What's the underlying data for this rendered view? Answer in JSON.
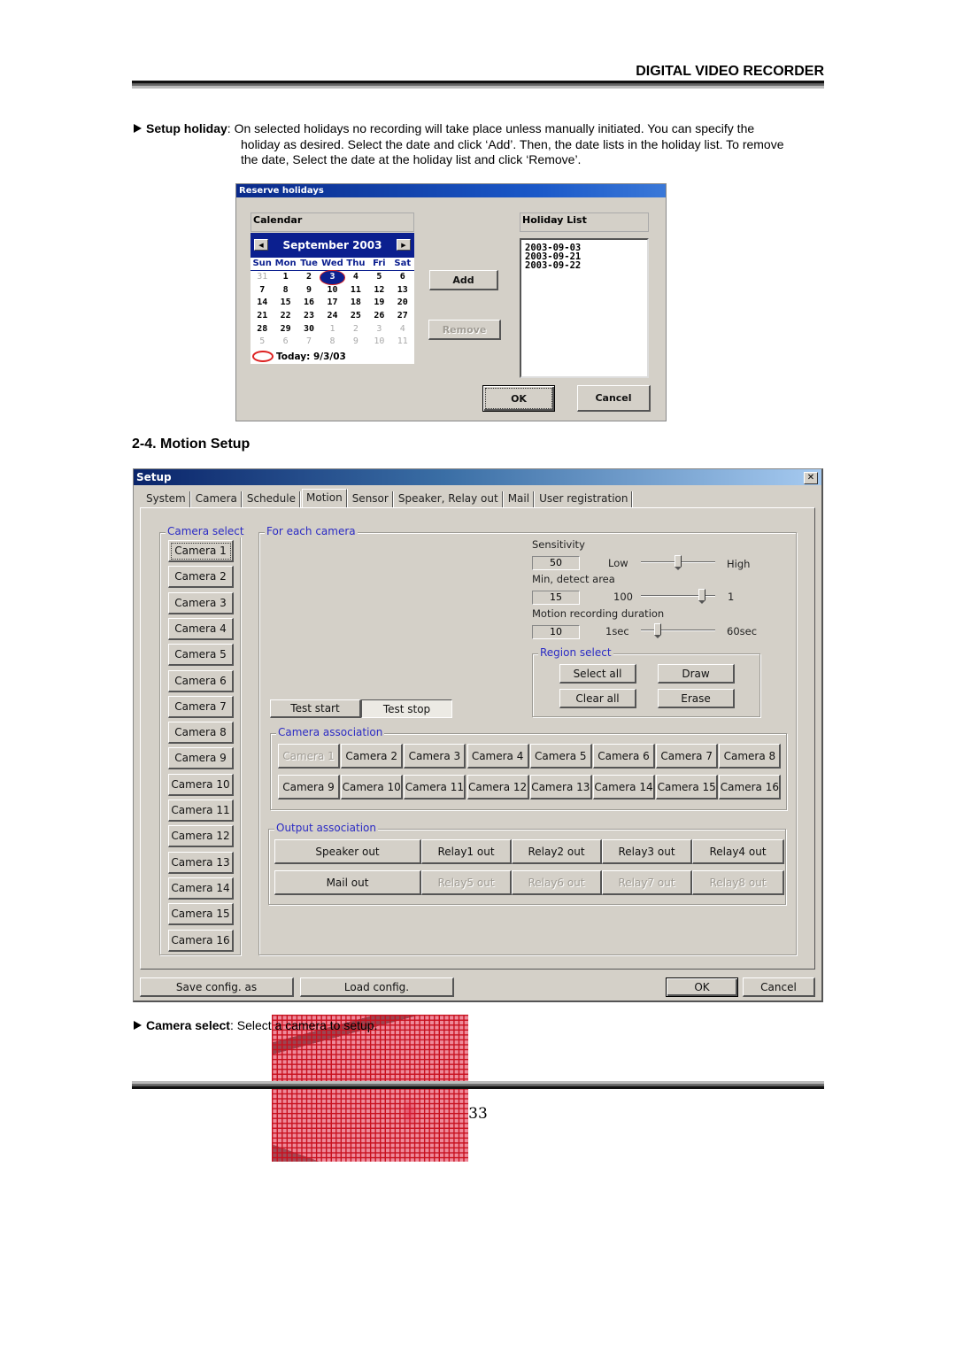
{
  "header": {
    "title": "DIGITAL VIDEO RECORDER"
  },
  "intro": {
    "lead": "Setup holiday",
    "line1": ": On selected holidays no recording will take place unless manually initiated. You can specify the",
    "line2": "holiday as desired. Select the date and click ‘Add’. Then, the date lists in the holiday list. To remove",
    "line3": "the date, Select the date at the holiday list and click ‘Remove’."
  },
  "holiday_dialog": {
    "title": "Reserve holidays",
    "calendar_label": "Calendar",
    "month_label": "September 2003",
    "prev_icon": "◀",
    "next_icon": "▶",
    "weekdays": [
      "Sun",
      "Mon",
      "Tue",
      "Wed",
      "Thu",
      "Fri",
      "Sat"
    ],
    "days": [
      {
        "d": "31",
        "other": true
      },
      {
        "d": "1"
      },
      {
        "d": "2"
      },
      {
        "d": "3",
        "selected": true
      },
      {
        "d": "4"
      },
      {
        "d": "5"
      },
      {
        "d": "6"
      },
      {
        "d": "7"
      },
      {
        "d": "8"
      },
      {
        "d": "9"
      },
      {
        "d": "10"
      },
      {
        "d": "11"
      },
      {
        "d": "12"
      },
      {
        "d": "13"
      },
      {
        "d": "14"
      },
      {
        "d": "15"
      },
      {
        "d": "16"
      },
      {
        "d": "17"
      },
      {
        "d": "18"
      },
      {
        "d": "19"
      },
      {
        "d": "20"
      },
      {
        "d": "21"
      },
      {
        "d": "22"
      },
      {
        "d": "23"
      },
      {
        "d": "24"
      },
      {
        "d": "25"
      },
      {
        "d": "26"
      },
      {
        "d": "27"
      },
      {
        "d": "28"
      },
      {
        "d": "29"
      },
      {
        "d": "30"
      },
      {
        "d": "1",
        "other": true
      },
      {
        "d": "2",
        "other": true
      },
      {
        "d": "3",
        "other": true
      },
      {
        "d": "4",
        "other": true
      },
      {
        "d": "5",
        "other": true
      },
      {
        "d": "6",
        "other": true
      },
      {
        "d": "7",
        "other": true
      },
      {
        "d": "8",
        "other": true
      },
      {
        "d": "9",
        "other": true
      },
      {
        "d": "10",
        "other": true
      },
      {
        "d": "11",
        "other": true
      }
    ],
    "today_label": "Today: 9/3/03",
    "add_label": "Add",
    "remove_label": "Remove",
    "holiday_list_label": "Holiday List",
    "holidays": [
      "2003-09-03",
      "2003-09-21",
      "2003-09-22"
    ],
    "ok_label": "OK",
    "cancel_label": "Cancel"
  },
  "section": {
    "title": "2-4. Motion Setup"
  },
  "setup_dialog": {
    "title": "Setup",
    "close_icon": "✕",
    "tabs": [
      {
        "label": "System"
      },
      {
        "label": "Camera"
      },
      {
        "label": "Schedule"
      },
      {
        "label": "Motion",
        "active": true
      },
      {
        "label": "Sensor"
      },
      {
        "label": "Speaker, Relay out"
      },
      {
        "label": "Mail"
      },
      {
        "label": "User registration"
      }
    ],
    "camera_select": {
      "label": "Camera select",
      "cameras": [
        "Camera 1",
        "Camera 2",
        "Camera 3",
        "Camera 4",
        "Camera 5",
        "Camera 6",
        "Camera 7",
        "Camera 8",
        "Camera 9",
        "Camera 10",
        "Camera 11",
        "Camera 12",
        "Camera 13",
        "Camera 14",
        "Camera 15",
        "Camera 16"
      ],
      "selected": "Camera 1"
    },
    "for_each_camera": {
      "label": "For each camera",
      "test_start": "Test start",
      "test_stop": "Test stop",
      "sensitivity": {
        "label": "Sensitivity",
        "value": "50",
        "min_label": "Low",
        "max_label": "High",
        "position": 0.5
      },
      "min_detect_area": {
        "label": "Min, detect area",
        "value": "15",
        "min_label": "100",
        "max_label": "1",
        "position": 0.86
      },
      "motion_duration": {
        "label": "Motion recording duration",
        "value": "10",
        "min_label": "1sec",
        "max_label": "60sec",
        "position": 0.2
      },
      "region_select": {
        "label": "Region select",
        "select_all": "Select all",
        "draw": "Draw",
        "clear_all": "Clear all",
        "erase": "Erase"
      }
    },
    "camera_association": {
      "label": "Camera association",
      "cameras": [
        {
          "label": "Camera 1",
          "disabled": true
        },
        {
          "label": "Camera 2"
        },
        {
          "label": "Camera 3"
        },
        {
          "label": "Camera 4"
        },
        {
          "label": "Camera 5"
        },
        {
          "label": "Camera 6"
        },
        {
          "label": "Camera 7"
        },
        {
          "label": "Camera 8"
        },
        {
          "label": "Camera 9"
        },
        {
          "label": "Camera 10"
        },
        {
          "label": "Camera 11"
        },
        {
          "label": "Camera 12"
        },
        {
          "label": "Camera 13"
        },
        {
          "label": "Camera 14"
        },
        {
          "label": "Camera 15"
        },
        {
          "label": "Camera 16"
        }
      ]
    },
    "output_association": {
      "label": "Output association",
      "outputs": [
        {
          "label": "Speaker out"
        },
        {
          "label": "Relay1 out"
        },
        {
          "label": "Relay2 out"
        },
        {
          "label": "Relay3 out"
        },
        {
          "label": "Relay4 out"
        },
        {
          "label": "Mail out"
        },
        {
          "label": "Relay5 out",
          "disabled": true
        },
        {
          "label": "Relay6 out",
          "disabled": true
        },
        {
          "label": "Relay7 out",
          "disabled": true
        },
        {
          "label": "Relay8 out",
          "disabled": true
        }
      ]
    },
    "footer": {
      "save_config": "Save config. as",
      "load_config": "Load config.",
      "ok": "OK",
      "cancel": "Cancel"
    }
  },
  "bottom_note": {
    "lead": "Camera select",
    "text": ": Select a camera to setup."
  },
  "page_number": "33"
}
